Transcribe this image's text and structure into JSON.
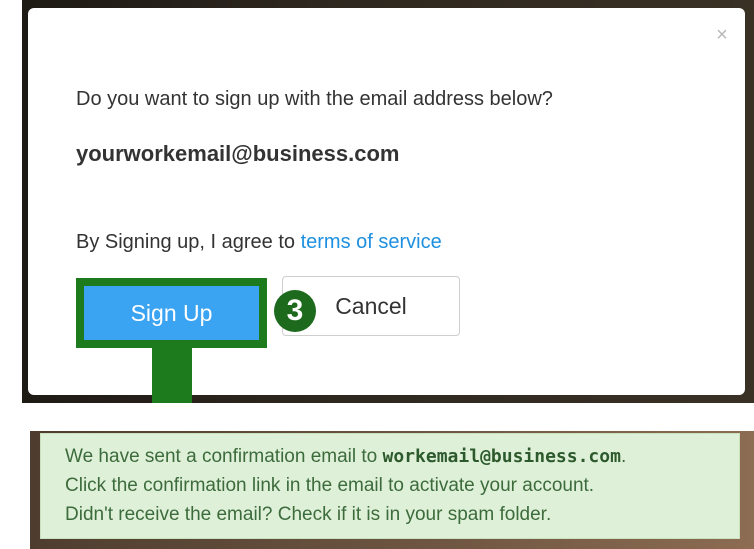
{
  "modal": {
    "close_symbol": "×",
    "question": "Do you want to sign up with the email address below?",
    "email": "yourworkemail@business.com",
    "agree_prefix": "By Signing up, I agree to ",
    "agree_link": "terms of service",
    "signup_label": "Sign Up",
    "cancel_label": "Cancel",
    "step_number": "3"
  },
  "notice": {
    "line1_prefix": "We have sent a confirmation email to ",
    "line1_email": "workemail@business.com",
    "line1_suffix": ".",
    "line2": "Click the confirmation link in the email to activate your account.",
    "line3": "Didn't receive the email? Check if it is in your spam folder."
  },
  "colors": {
    "primary_button": "#3aa3f2",
    "highlight_green": "#1d7a1d",
    "link": "#1e90e0",
    "notice_bg": "#dff0d8"
  }
}
